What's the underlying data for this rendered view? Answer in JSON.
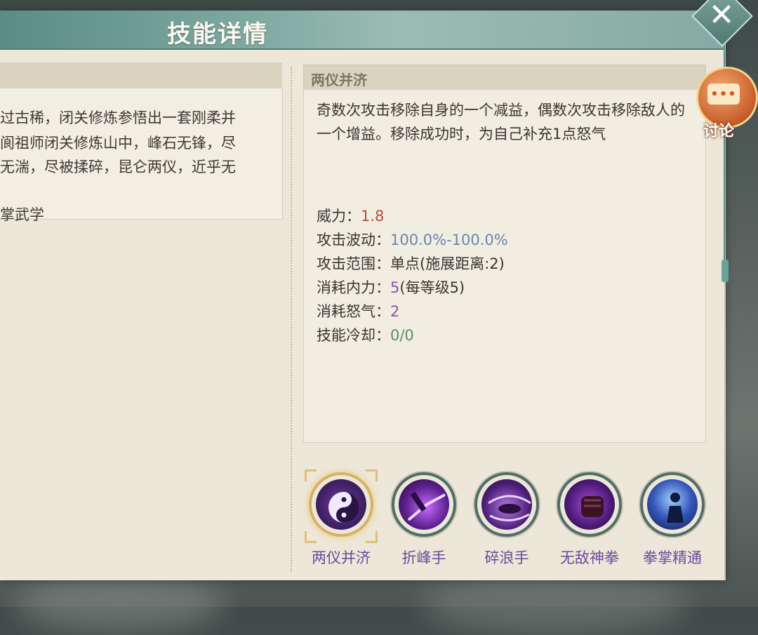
{
  "window": {
    "title": "技能详情"
  },
  "left_description": {
    "lines": [
      "过古稀，闭关修炼参悟出一套刚柔并",
      "阆祖师闭关修炼山中，峰石无锋，尽",
      "无湍，尽被揉碎，昆仑两仪，近乎无",
      "掌武学"
    ]
  },
  "skill_detail": {
    "name": "两仪并济",
    "description": "奇数次攻击移除自身的一个减益，偶数次攻击移除敌人的一个增益。移除成功时，为自己补充1点怒气",
    "stats": [
      {
        "label": "威力：",
        "value": "1.8"
      },
      {
        "label": "攻击波动：",
        "value": "100.0%-100.0%"
      },
      {
        "label": "攻击范围：",
        "value": "单点(施展距离:2)"
      },
      {
        "label": "消耗内力：",
        "value": "5",
        "extra": "(每等级5)"
      },
      {
        "label": "消耗怒气：",
        "value": "2"
      },
      {
        "label": "技能冷却：",
        "value": "0/0"
      }
    ]
  },
  "skills": [
    {
      "name": "两仪并济",
      "icon": "yin-yang-icon",
      "selected": true
    },
    {
      "name": "折峰手",
      "icon": "claw-strike-icon",
      "selected": false
    },
    {
      "name": "碎浪手",
      "icon": "wave-hands-icon",
      "selected": false
    },
    {
      "name": "无敌神拳",
      "icon": "fist-icon",
      "selected": false
    },
    {
      "name": "拳掌精通",
      "icon": "meditation-figure-icon",
      "selected": false
    }
  ],
  "buttons": {
    "discuss_label": "讨论"
  },
  "colors": {
    "title_bar": "#7fa9a2",
    "power_value": "#b6503c",
    "wave_value": "#6a86b0",
    "cost_value": "#8a55b0",
    "cooldown_value": "#5e8c5e",
    "skill_label": "#6a4b9e"
  }
}
